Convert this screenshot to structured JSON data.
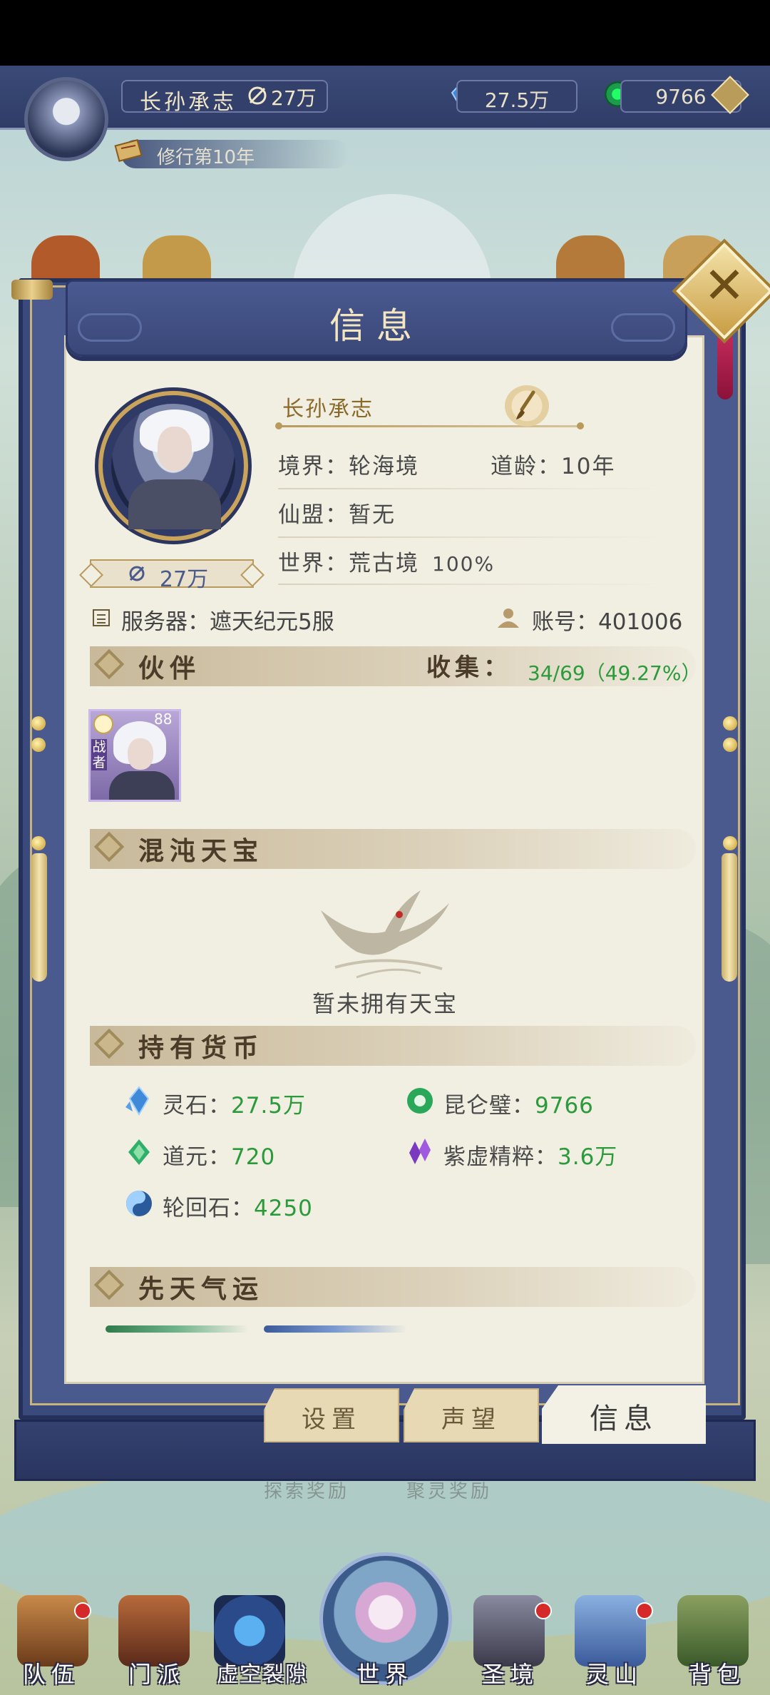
{
  "hud": {
    "player_name": "长孙承志",
    "power": "27万",
    "spirit_stone": "27.5万",
    "kunlun_jade": "9766",
    "cultivation_year": "修行第10年"
  },
  "panel": {
    "title": "信息",
    "profile": {
      "name": "长孙承志",
      "power": "27万",
      "realm_label": "境界：",
      "realm_value": "轮海境",
      "dao_age_label": "道龄：",
      "dao_age_value": "10年",
      "alliance_label": "仙盟：",
      "alliance_value": "暂无",
      "world_label": "世界：",
      "world_value": "荒古境",
      "world_percent": "100%",
      "server_label": "服务器：",
      "server_value": "遮天纪元5服",
      "account_label": "账号：",
      "account_value": "401006"
    },
    "partners": {
      "title": "伙伴",
      "collect_label": "收集：",
      "collect_value": "34/69（49.27%）",
      "items": [
        {
          "level": "88",
          "tag": "战者"
        }
      ]
    },
    "treasure": {
      "title": "混沌天宝",
      "empty_text": "暂未拥有天宝"
    },
    "currency": {
      "title": "持有货币",
      "items": [
        {
          "label": "灵石：",
          "value": "27.5万",
          "icon": "spirit-stone-icon"
        },
        {
          "label": "昆仑璧：",
          "value": "9766",
          "icon": "kunlun-jade-icon"
        },
        {
          "label": "道元：",
          "value": "720",
          "icon": "dao-yuan-icon"
        },
        {
          "label": "紫虚精粹：",
          "value": "3.6万",
          "icon": "purple-essence-icon"
        },
        {
          "label": "轮回石：",
          "value": "4250",
          "icon": "reincarnation-stone-icon"
        }
      ]
    },
    "fortune": {
      "title": "先天气运"
    },
    "tabs": [
      {
        "label": "设置",
        "active": false
      },
      {
        "label": "声望",
        "active": false
      },
      {
        "label": "信息",
        "active": true
      }
    ]
  },
  "background_text": [
    "探索奖励",
    "聚灵奖励"
  ],
  "bottom_nav": [
    {
      "label": "队伍",
      "badge": true
    },
    {
      "label": "门派",
      "badge": false
    },
    {
      "label": "虚空裂隙",
      "badge": false
    },
    {
      "label": "世界",
      "badge": false
    },
    {
      "label": "圣境",
      "badge": true
    },
    {
      "label": "灵山",
      "badge": true
    },
    {
      "label": "背包",
      "badge": false
    }
  ],
  "colors": {
    "value_green": "#2b9a3a",
    "panel_blue": "#3b4a7d",
    "gold": "#c9a45a",
    "paper": "#f1eee2"
  }
}
